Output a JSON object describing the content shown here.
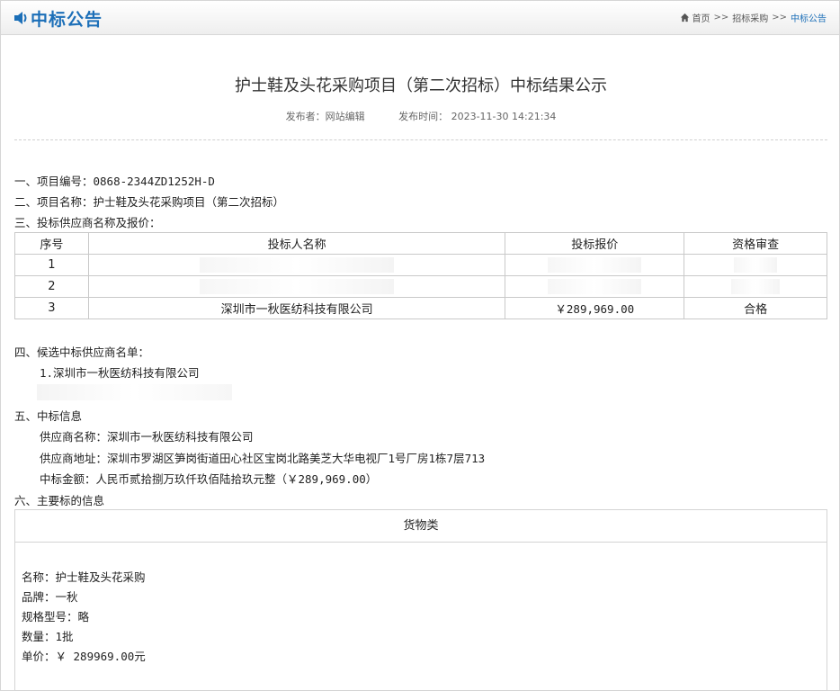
{
  "header": {
    "title": "中标公告",
    "breadcrumb": [
      "首页",
      "招标采购",
      "中标公告"
    ],
    "breadcrumb_sep": ">>"
  },
  "article": {
    "title": "护士鞋及头花采购项目（第二次招标）中标结果公示",
    "publisher": "发布者：网站编辑",
    "publish_time": "发布时间： 2023-11-30 14:21:34"
  },
  "sections": {
    "project_no": "一、项目编号：0868-2344ZD1252H-D",
    "project_name": "二、项目名称：护士鞋及头花采购项目（第二次招标）",
    "bidders_heading": "三、投标供应商名称及报价：",
    "candidates_heading": "四、候选中标供应商名单：",
    "candidate_1": "1.深圳市一秋医纺科技有限公司",
    "award_heading": "五、中标信息",
    "supplier_name": "供应商名称：深圳市一秋医纺科技有限公司",
    "supplier_address": "供应商地址：深圳市罗湖区笋岗街道田心社区宝岗北路美芝大华电视厂1号厂房1栋7层713",
    "award_amount": "中标金额：人民币贰拾捌万玖仟玖佰陆拾玖元整（￥289,969.00）",
    "main_item_heading": "六、主要标的信息"
  },
  "bid_table": {
    "headers": [
      "序号",
      "投标人名称",
      "投标报价",
      "资格审查"
    ],
    "rows": [
      {
        "no": "1",
        "name": "",
        "price": "",
        "review": ""
      },
      {
        "no": "2",
        "name": "",
        "price": "",
        "review": ""
      },
      {
        "no": "3",
        "name": "深圳市一秋医纺科技有限公司",
        "price": "￥289,969.00",
        "review": "合格"
      }
    ]
  },
  "goods": {
    "category": "货物类",
    "name": "名称：护士鞋及头花采购",
    "brand": "品牌：一秋",
    "model": "规格型号：略",
    "quantity": "数量：1批",
    "unit_price": "单价：￥ 289969.00元"
  },
  "colors": {
    "brand": "#1c6fb8",
    "text": "#222222",
    "border": "#c9c9c9"
  }
}
